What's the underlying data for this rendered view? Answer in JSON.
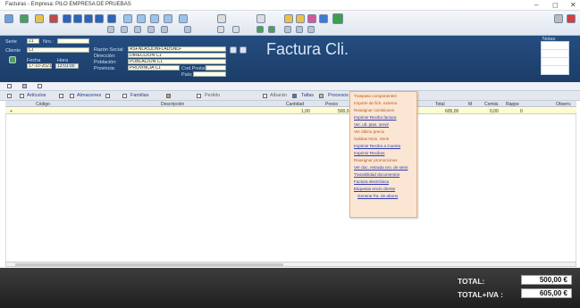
{
  "window": {
    "title": "Facturas - Empresa: PILO EMPRESA DE PRUEBAS",
    "minimize": "–",
    "maximize": "◻",
    "close": "✕"
  },
  "header": {
    "serie_label": "Serie",
    "serie_value": "21",
    "nro_label": "Nro.:",
    "nro_value": "",
    "cliente_label": "Cliente",
    "cliente_value": "CI",
    "fecha_label": "Fecha",
    "fecha_value": "17-10-2021",
    "hora_label": "Hora",
    "hora_value": "13:01:00",
    "razon_label": "Razón Social:",
    "razon_value": "ASFÑLASJDÑFLADSÑLF",
    "direccion_label": "Dirección:",
    "direccion_value": "DIRECCION C1",
    "poblacion_label": "Población:",
    "poblacion_value": "POBLACION C1",
    "provincia_label": "Provincia:",
    "provincia_value": "PROVINCIA C1",
    "cod_postal_label": "Cod.Postal:",
    "pais_label": "País:",
    "title": "Factura Cli.",
    "notas_label": "Notas"
  },
  "filters": {
    "articulos": "Artículos",
    "almacenes": "Almacenes",
    "familias": "Familias",
    "pedido": "Pedido",
    "albaran": "Albarán",
    "tallas": "Tallas",
    "procesos": "Procesos"
  },
  "grid": {
    "columns": [
      "Código",
      "Descripción",
      "Cantidad",
      "Precio",
      "Total",
      "M",
      "Comisi.",
      "Rappe",
      "Observ."
    ],
    "row": {
      "marker": "+",
      "cantidad": "1,00",
      "precio": "500,0",
      "total": "605,00",
      "comision": "0,00",
      "rappel": "0"
    }
  },
  "context_menu": [
    {
      "label": "Traspasa componentes",
      "style": "o"
    },
    {
      "label": "Importe de fich. externo",
      "style": "o"
    },
    {
      "label": "Reasignar comisiones",
      "style": "o"
    },
    {
      "label": "Imprimir Recibo factura",
      "style": "u"
    },
    {
      "label": "Ver. ult. ptas. servir",
      "style": "u"
    },
    {
      "label": "Ver último precio",
      "style": "o"
    },
    {
      "label": "Salidas Nros. Serie",
      "style": "o"
    },
    {
      "label": "Imprimir Recibo a Cuenta",
      "style": "u"
    },
    {
      "label": "Imprimir Recibos",
      "style": "u"
    },
    {
      "label": "Reasignar promociones",
      "style": "o"
    },
    {
      "label": "Ver doc. entrada nro. de serie",
      "style": "u"
    },
    {
      "label": "Trazabilidad documentos",
      "style": "u"
    },
    {
      "label": "Factura electrónica",
      "style": "u"
    },
    {
      "label": "Etiquetas envío cliente",
      "style": "u"
    },
    {
      "label": "Generar fra. de abono",
      "style": "u"
    }
  ],
  "footer": {
    "total_label": "TOTAL:",
    "total_value": "500,00 €",
    "total_iva_label": "TOTAL+IVA :",
    "total_iva_value": "605,00 €"
  },
  "colors": {
    "header_bg": "#244d80",
    "field_bg": "#fffbd0",
    "menu_bg": "#fbe6d3",
    "footer_bg": "#2a2a2a"
  }
}
